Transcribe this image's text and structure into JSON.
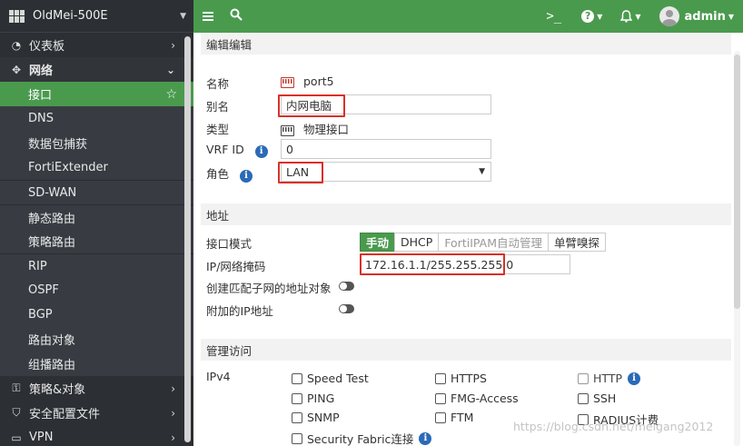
{
  "device": {
    "name": "OldMei-500E"
  },
  "nav": {
    "top": [
      {
        "label": "仪表板",
        "icon": "dashboard-icon"
      },
      {
        "label": "网络",
        "icon": "network-icon"
      }
    ],
    "network_sub": [
      {
        "label": "接口"
      },
      {
        "label": "DNS"
      },
      {
        "label": "数据包捕获"
      },
      {
        "label": "FortiExtender"
      },
      {
        "label": "SD-WAN"
      },
      {
        "label": "静态路由"
      },
      {
        "label": "策略路由"
      },
      {
        "label": "RIP"
      },
      {
        "label": "OSPF"
      },
      {
        "label": "BGP"
      },
      {
        "label": "路由对象"
      },
      {
        "label": "组播路由"
      }
    ],
    "bottom": [
      {
        "label": "策略&对象",
        "icon": "policy-icon"
      },
      {
        "label": "安全配置文件",
        "icon": "shield-icon"
      },
      {
        "label": "VPN",
        "icon": "monitor-icon"
      }
    ]
  },
  "topbar": {
    "user": "admin",
    "cli": ">_"
  },
  "form": {
    "edit_header": "编辑编辑",
    "name_label": "名称",
    "name_value": "port5",
    "alias_label": "别名",
    "alias_value": "内网电脑",
    "type_label": "类型",
    "type_value": "物理接口",
    "vrf_label": "VRF ID",
    "vrf_value": "0",
    "role_label": "角色",
    "role_value": "LAN",
    "address_header": "地址",
    "mode_label": "接口模式",
    "modes": [
      "手动",
      "DHCP",
      "FortiIPAM自动管理",
      "单臂嗅探"
    ],
    "ip_label": "IP/网络掩码",
    "ip_value": "172.16.1.1/255.255.255.0",
    "create_addr_label": "创建匹配子网的地址对象",
    "secondary_ip_label": "附加的IP地址",
    "admin_header": "管理访问",
    "ipv4_label": "IPv4",
    "access": {
      "speed_test": "Speed Test",
      "https": "HTTPS",
      "http": "HTTP",
      "ping": "PING",
      "fmg": "FMG-Access",
      "ssh": "SSH",
      "snmp": "SNMP",
      "ftm": "FTM",
      "radius": "RADIUS计费",
      "fabric": "Security Fabric连接"
    }
  },
  "watermark": "https://blog.csdn.net/meigang2012"
}
